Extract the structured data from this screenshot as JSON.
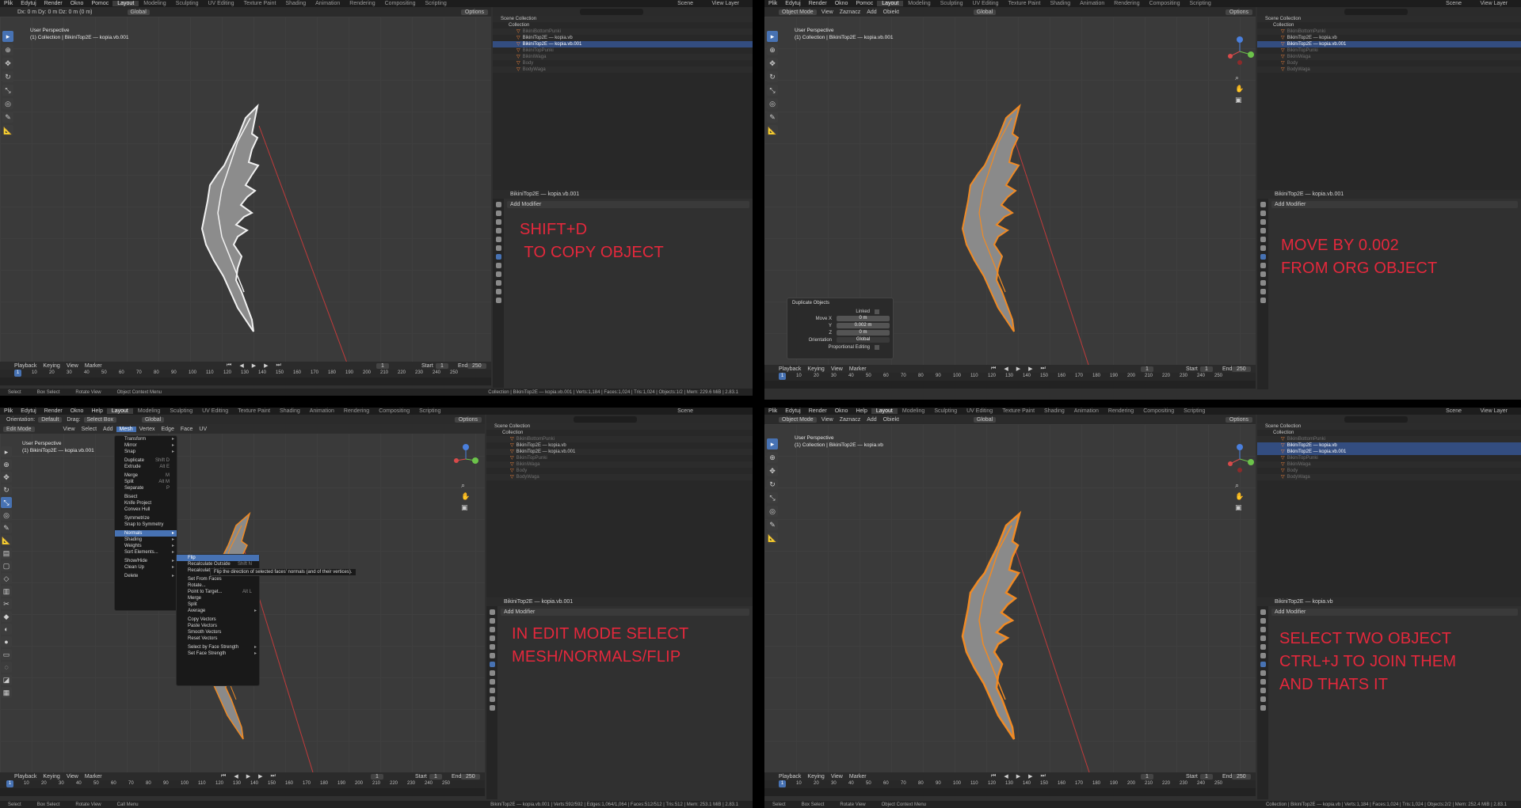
{
  "menus": {
    "top_main": [
      "Plik",
      "Edytuj",
      "Render",
      "Okno",
      "Pomoc"
    ],
    "top_alt": [
      "Plik",
      "Edytuj",
      "Render",
      "Okno",
      "Help"
    ],
    "workspaces": [
      "Layout",
      "Modeling",
      "Sculpting",
      "UV Editing",
      "Texture Paint",
      "Shading",
      "Animation",
      "Rendering",
      "Compositing",
      "Scripting"
    ],
    "scene": "Scene",
    "view_layer": "View Layer"
  },
  "viewport": {
    "mode_object": "Object Mode",
    "mode_edit": "Edit Mode",
    "view_items": [
      "View",
      "Zaznacz",
      "Add",
      "Obiekt"
    ],
    "edit_items": [
      "View",
      "Select",
      "Add",
      "Mesh",
      "Vertex",
      "Edge",
      "Face",
      "UV"
    ],
    "orientation_label": "Orientation:",
    "orientation_value": "Default",
    "drag_label": "Drag:",
    "drag_value": "Select Box",
    "transform_space": "Global",
    "options": "Options",
    "persp": "User Perspective",
    "obj_tl": "(1) Collection | BikiniTop2E — kopia.vb.001",
    "obj_tr": "(1) Collection | BikiniTop2E — kopia.vb.001",
    "obj_bl": "(1) BikiniTop2E — kopia.vb.001",
    "obj_br": "(1) Collection | BikiniTop2E — kopia.vb",
    "delta_readout": "Dx: 0 m  Dy: 0 m  Dz: 0 m (0 m)"
  },
  "outliner": {
    "scene_collection": "Scene Collection",
    "collection": "Collection",
    "items": [
      "BikiniBottomPunki",
      "BikiniTop2E — kopia.vb",
      "BikiniTop2E — kopia.vb.001",
      "BikiniTopPunki",
      "BikiniWaga",
      "Body",
      "BodyWaga"
    ]
  },
  "properties": {
    "object_name_tl": "BikiniTop2E — kopia.vb.001",
    "object_name_tr": "BikiniTop2E — kopia.vb.001",
    "object_name_bl": "BikiniTop2E — kopia.vb.001",
    "object_name_br": "BikiniTop2E — kopia.vb",
    "add_modifier": "Add Modifier"
  },
  "duplicate_panel": {
    "title": "Duplicate Objects",
    "linked": "Linked",
    "move_x_label": "Move X",
    "move_x": "0 m",
    "y_label": "Y",
    "y": "0.002 m",
    "z_label": "Z",
    "z": "0 m",
    "orientation_label": "Orientation",
    "orientation": "Global",
    "prop_edit": "Proportional Editing"
  },
  "annotations": {
    "tl": "SHIFT+D\n TO COPY OBJECT",
    "tr": "MOVE BY 0.002\nFROM ORG OBJECT",
    "bl": "IN EDIT MODE SELECT\nMESH/NORMALS/FLIP",
    "br": "SELECT TWO OBJECT\nCTRL+J TO JOIN THEM\nAND THATS IT"
  },
  "timeline": {
    "playback": "Playback",
    "keying": "Keying",
    "view": "View",
    "marker": "Marker",
    "current_frame": "1",
    "start_label": "Start",
    "start": "1",
    "end_label": "End",
    "end": "250",
    "ticks": [
      "10",
      "20",
      "30",
      "40",
      "50",
      "60",
      "70",
      "80",
      "90",
      "100",
      "110",
      "120",
      "130",
      "140",
      "150",
      "160",
      "170",
      "180",
      "190",
      "200",
      "210",
      "220",
      "230",
      "240",
      "250"
    ]
  },
  "status": {
    "select": "Select",
    "box_select": "Box Select",
    "rotate_view": "Rotate View",
    "object_context": "Object Context Menu",
    "call_menu": "Call Menu",
    "stats_tl": "Collection | BikiniTop2E — kopia.vb.001 | Verts:1,184 | Faces:1,024 | Tris:1,024 | Objects:1/2 | Mem: 229.6 MiB | 2.83.1",
    "stats_bl": "BikiniTop2E — kopia.vb.001 | Verts:592/592 | Edges:1,064/1,064 | Faces:512/512 | Tris:512 | Mem: 253.1 MiB | 2.83.1",
    "stats_br": "Collection | BikiniTop2E — kopia.vb | Verts:1,184 | Faces:1,024 | Tris:1,024 | Objects:2/2 | Mem: 252.4 MiB | 2.83.1"
  },
  "mesh_menu": {
    "items": [
      "Transform",
      "Mirror",
      "Snap",
      "",
      "Duplicate",
      "Extrude",
      "",
      "Merge",
      "Split",
      "Separate",
      "",
      "Bisect",
      "Knife Project",
      "Convex Hull",
      "",
      "Symmetrize",
      "Snap to Symmetry",
      "",
      "Normals",
      "Shading",
      "Weights",
      "Sort Elements...",
      "",
      "Show/Hide",
      "Clean Up",
      "",
      "Delete"
    ],
    "shortcuts": {
      "Duplicate": "Shift D",
      "Extrude": "Alt E",
      "Merge": "M",
      "Split": "Alt M",
      "Separate": "P",
      "Delete": "X"
    },
    "highlight": "Normals"
  },
  "normals_menu": {
    "items": [
      "Flip",
      "Recalculate Outside",
      "Recalculate Inside",
      "",
      "Set From Faces",
      "Rotate...",
      "Point to Target...",
      "Merge",
      "Split",
      "Average",
      "",
      "Copy Vectors",
      "Paste Vectors",
      "Smooth Vectors",
      "Reset Vectors",
      "",
      "Select by Face Strength",
      "Set Face Strength"
    ],
    "shortcuts": {
      "Recalculate Outside": "Shift N",
      "Point to Target...": "Alt L"
    },
    "highlight": "Flip"
  },
  "tooltip": "Flip the direction of selected faces' normals (and of their vertices).",
  "colors": {
    "accent": "#4772b3",
    "annotation": "#e5283c",
    "orange": "#f08a24",
    "mesh_white": "#f2f2f2",
    "mesh_fill": "#8e8e8e"
  }
}
